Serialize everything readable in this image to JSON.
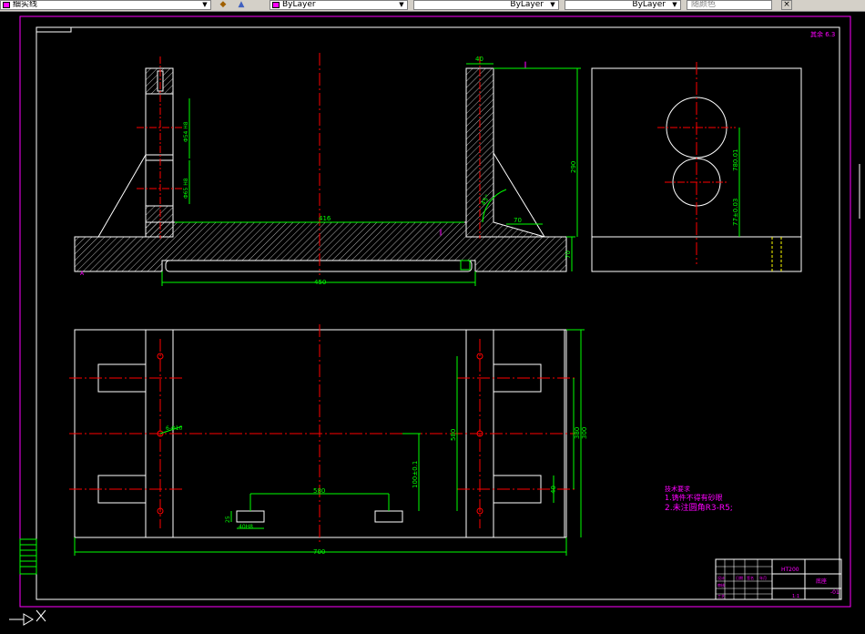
{
  "toolbar": {
    "layer_name": "细实线",
    "color_value": "ByLayer",
    "linetype_value": "ByLayer",
    "lineweight_value": "ByLayer",
    "plotstyle_value": "随颜色"
  },
  "drawing": {
    "dims_front": {
      "top_width": "40",
      "flatness_sym": "∥",
      "height": "290",
      "span": "416",
      "base_len": "450",
      "base_thk": "70",
      "rib": "70",
      "angle": "45°",
      "bore_top": "Φ54 H8",
      "bore_low": "Φ65 H8",
      "r_label": "R",
      "flat_mid": "∥",
      "sect_mark": "A"
    },
    "dims_side": {
      "d1": "780.01",
      "d2": "77±0.03"
    },
    "dims_plan": {
      "overall": "700",
      "slot_span": "580",
      "bore_span": "580",
      "depth": "100±0.1",
      "h1": "380",
      "h2": "300",
      "slot_w": "40",
      "slot_len": "40",
      "hole_label": "6-Φ10",
      "slot_dim": "25",
      "slot_call": "40H8"
    },
    "notes": {
      "title": "技术要求",
      "line1": "1.铸件不得有砂眼",
      "line2": "2.未注圆角R3-R5;"
    },
    "title_block": {
      "material": "HT200",
      "name": "底座",
      "scale": "1:1",
      "dwg_no": "-01"
    },
    "corner_mark": "其余 6.3"
  }
}
